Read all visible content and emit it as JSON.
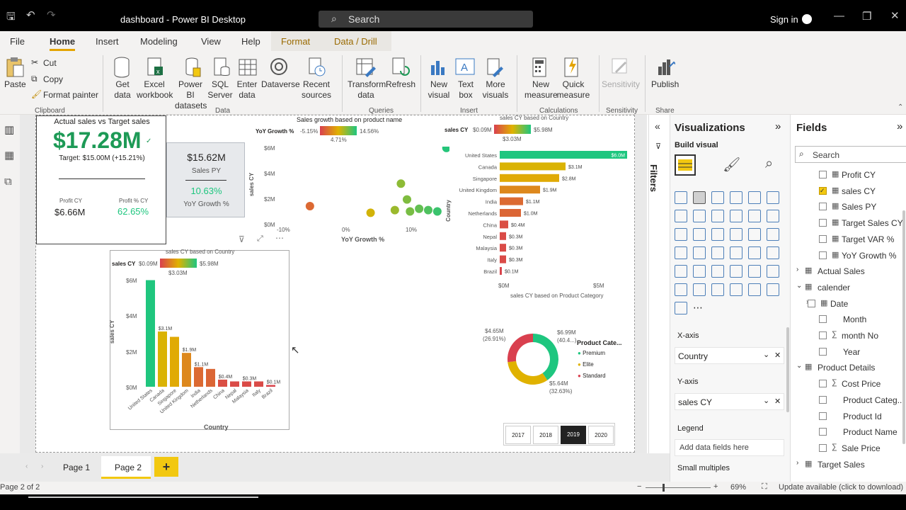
{
  "window": {
    "title": "dashboard - Power BI Desktop",
    "search_placeholder": "Search",
    "sign_in": "Sign in"
  },
  "menu": [
    "File",
    "Home",
    "Insert",
    "Modeling",
    "View",
    "Help",
    "Format",
    "Data / Drill"
  ],
  "ribbon": {
    "clipboard": {
      "paste": "Paste",
      "cut": "Cut",
      "copy": "Copy",
      "format_painter": "Format painter",
      "group": "Clipboard"
    },
    "data": {
      "get_data": "Get data",
      "excel": "Excel workbook",
      "pbi_datasets": "Power BI datasets",
      "sql": "SQL Server",
      "enter": "Enter data",
      "dataverse": "Dataverse",
      "recent": "Recent sources",
      "group": "Data"
    },
    "queries": {
      "transform": "Transform data",
      "refresh": "Refresh",
      "group": "Queries"
    },
    "insert": {
      "new_visual": "New visual",
      "text_box": "Text box",
      "more_visuals": "More visuals",
      "group": "Insert"
    },
    "calculations": {
      "new_measure": "New measure",
      "quick_measure": "Quick measure",
      "group": "Calculations"
    },
    "sensitivity": {
      "label": "Sensitivity",
      "group": "Sensitivity"
    },
    "share": {
      "publish": "Publish",
      "group": "Share"
    }
  },
  "kpi": {
    "title": "Actual sales vs Target sales",
    "value": "$17.28M",
    "target": "Target: $15.00M (+15.21%)",
    "profit_label": "Profit CY",
    "profit_value": "$6.66M",
    "profit_pct_label": "Profit % CY",
    "profit_pct_value": "62.65%"
  },
  "py_card": {
    "value": "$15.62M",
    "label": "Sales PY",
    "yoy_value": "10.63%",
    "yoy_label": "YoY Growth %"
  },
  "scatter": {
    "title": "Sales growth based on product name",
    "legend_label": "YoY Growth %",
    "legend_min": "-5.15%",
    "legend_max": "14.56%",
    "legend_mid": "4.71%",
    "ylabel": "sales CY",
    "xlabel": "YoY Growth %",
    "yticks": [
      "$6M",
      "$4M",
      "$2M",
      "$0M"
    ],
    "xticks": [
      "-10%",
      "0%",
      "10%"
    ]
  },
  "hbar": {
    "title": "sales CY based on Country",
    "legend_label": "sales CY",
    "legend_min": "$0.09M",
    "legend_max": "$5.98M",
    "legend_mid": "$3.03M",
    "ylabel": "Country",
    "xticks": [
      "$0M",
      "$5M"
    ]
  },
  "vbar": {
    "title": "sales CY based on Country",
    "legend_label": "sales CY",
    "legend_min": "$0.09M",
    "legend_max": "$5.98M",
    "legend_mid": "$3.03M",
    "ylabel": "sales CY",
    "xlabel": "Country",
    "yticks": [
      "$6M",
      "$4M",
      "$2M",
      "$0M"
    ]
  },
  "donut": {
    "title": "sales CY based on Product Category",
    "legend_title": "Product Cate...",
    "labels": {
      "premium_val": "$6.99M",
      "premium_pct": "(40.4...)",
      "elite_val": "$5.64M",
      "elite_pct": "(32.63%)",
      "standard_val": "$4.65M",
      "standard_pct": "(26.91%)"
    }
  },
  "years": [
    "2017",
    "2018",
    "2019",
    "2020"
  ],
  "chart_data": [
    {
      "type": "bar",
      "title": "sales CY based on Country",
      "orientation": "horizontal",
      "categories": [
        "United States",
        "Canada",
        "Singapore",
        "United Kingdom",
        "India",
        "Netherlands",
        "China",
        "Nepal",
        "Malaysia",
        "Italy",
        "Brazil"
      ],
      "values": [
        6.0,
        3.1,
        2.8,
        1.9,
        1.1,
        1.0,
        0.4,
        0.3,
        0.3,
        0.3,
        0.1
      ],
      "data_labels": [
        "$6.0M",
        "$3.1M",
        "$2.8M",
        "$1.9M",
        "$1.1M",
        "$1.0M",
        "$0.4M",
        "$0.3M",
        "$0.3M",
        "$0.3M",
        "$0.1M"
      ],
      "xlim": [
        0,
        6
      ],
      "ylabel": "Country"
    },
    {
      "type": "bar",
      "title": "sales CY based on Country",
      "orientation": "vertical",
      "categories": [
        "United States",
        "Canada",
        "Singapore",
        "United Kingdom",
        "India",
        "Netherlands",
        "China",
        "Nepal",
        "Malaysia",
        "Italy",
        "Brazil"
      ],
      "values": [
        5.98,
        3.1,
        2.8,
        1.9,
        1.1,
        1.0,
        0.4,
        0.3,
        0.3,
        0.3,
        0.1
      ],
      "data_labels": [
        "",
        "$3.1M",
        "",
        "$1.9M",
        "$1.1M",
        "",
        "$0.4M",
        "",
        "$0.3M",
        "",
        "$0.1M"
      ],
      "ylim": [
        0,
        6
      ],
      "xlabel": "Country",
      "ylabel": "sales CY"
    },
    {
      "type": "scatter",
      "title": "Sales growth based on product name",
      "points": [
        [
          -7,
          1.5
        ],
        [
          3,
          1.0
        ],
        [
          8,
          3.2
        ],
        [
          9,
          2.0
        ],
        [
          7,
          1.2
        ],
        [
          9.5,
          1.1
        ],
        [
          11,
          1.3
        ],
        [
          12.5,
          1.2
        ],
        [
          14,
          1.1
        ],
        [
          15.5,
          5.9
        ]
      ],
      "xlim": [
        -12,
        16
      ],
      "ylim": [
        0,
        6
      ],
      "xlabel": "YoY Growth %",
      "ylabel": "sales CY"
    },
    {
      "type": "pie",
      "title": "sales CY based on Product Category",
      "categories": [
        "Premium",
        "Elite",
        "Standard"
      ],
      "values": [
        6.99,
        5.64,
        4.65
      ],
      "colors": [
        "#1ec67f",
        "#e0b200",
        "#d9404f"
      ]
    }
  ],
  "visualizations": {
    "title": "Visualizations",
    "build_visual": "Build visual",
    "xaxis_label": "X-axis",
    "xaxis_field": "Country",
    "yaxis_label": "Y-axis",
    "yaxis_field": "sales CY",
    "legend_label": "Legend",
    "legend_placeholder": "Add data fields here",
    "small_multiples": "Small multiples"
  },
  "filters_label": "Filters",
  "fields": {
    "title": "Fields",
    "search_placeholder": "Search",
    "items": [
      {
        "label": "Profit CY",
        "checked": false,
        "level": 2,
        "type": "calc"
      },
      {
        "label": "sales CY",
        "checked": true,
        "level": 2,
        "type": "calc"
      },
      {
        "label": "Sales PY",
        "checked": false,
        "level": 2,
        "type": "calc"
      },
      {
        "label": "Target Sales CY",
        "checked": false,
        "level": 2,
        "type": "calc"
      },
      {
        "label": "Target VAR %",
        "checked": false,
        "level": 2,
        "type": "calc"
      },
      {
        "label": "YoY Growth %",
        "checked": false,
        "level": 2,
        "type": "calc"
      },
      {
        "label": "Actual Sales",
        "checked": false,
        "level": 0,
        "type": "table",
        "collapsed": true
      },
      {
        "label": "calender",
        "checked": false,
        "level": 0,
        "type": "table",
        "collapsed": false
      },
      {
        "label": "Date",
        "checked": false,
        "level": 1,
        "type": "date"
      },
      {
        "label": "Month",
        "checked": false,
        "level": 2,
        "type": "field"
      },
      {
        "label": "month No",
        "checked": false,
        "level": 2,
        "type": "sum"
      },
      {
        "label": "Year",
        "checked": false,
        "level": 2,
        "type": "field"
      },
      {
        "label": "Product Details",
        "checked": false,
        "level": 0,
        "type": "table",
        "collapsed": false
      },
      {
        "label": "Cost Price",
        "checked": false,
        "level": 2,
        "type": "sum"
      },
      {
        "label": "Product Categ...",
        "checked": false,
        "level": 2,
        "type": "field"
      },
      {
        "label": "Product Id",
        "checked": false,
        "level": 2,
        "type": "field"
      },
      {
        "label": "Product Name",
        "checked": false,
        "level": 2,
        "type": "field"
      },
      {
        "label": "Sale Price",
        "checked": false,
        "level": 2,
        "type": "sum"
      },
      {
        "label": "Target Sales",
        "checked": false,
        "level": 0,
        "type": "table",
        "collapsed": true
      }
    ]
  },
  "pages": [
    "Page 1",
    "Page 2"
  ],
  "add_page": "+",
  "status": {
    "page": "Page 2 of 2",
    "zoom": "69%",
    "update": "Update available (click to download)"
  }
}
